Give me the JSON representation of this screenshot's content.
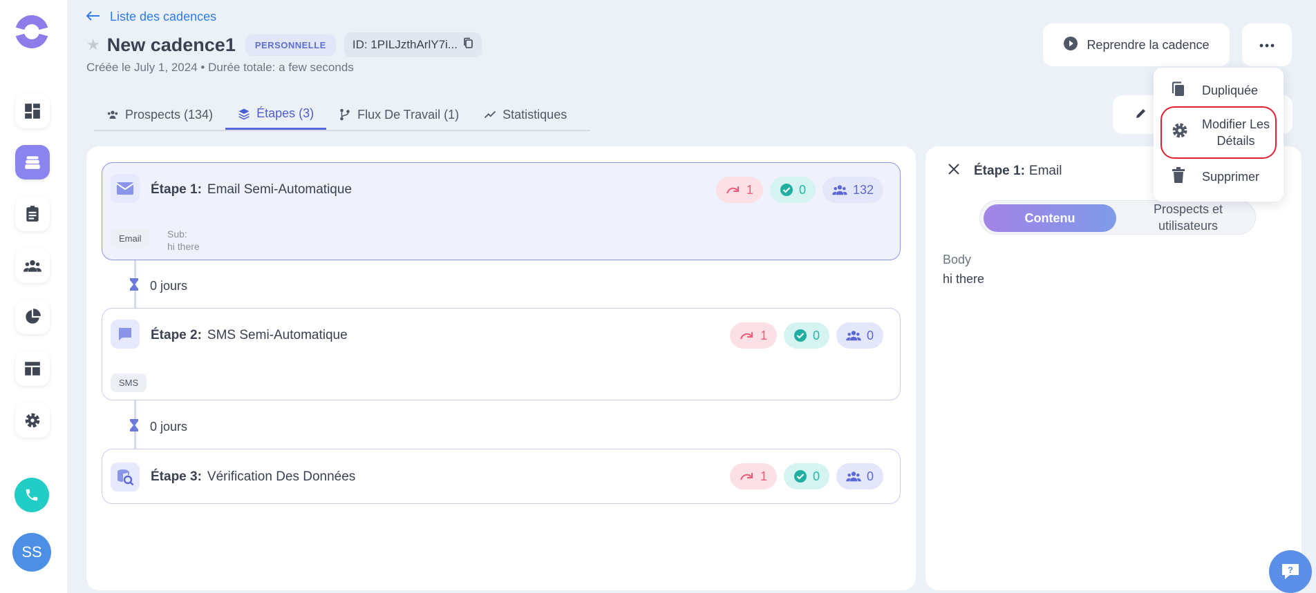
{
  "header": {
    "back_label": "Liste des cadences",
    "title": "New cadence1",
    "badge": "PERSONNELLE",
    "id_label": "ID: 1PILJzthArlY7i...",
    "subtitle": "Créée le July 1, 2024 • Durée totale: a few seconds",
    "resume_label": "Reprendre la cadence"
  },
  "tabs": [
    {
      "label": "Prospects (134)"
    },
    {
      "label": "Étapes (3)"
    },
    {
      "label": "Flux De Travail (1)"
    },
    {
      "label": "Statistiques"
    }
  ],
  "steps": [
    {
      "prefix": "Étape 1:",
      "name": "Email Semi-Automatique",
      "tag": "Email",
      "sub_label": "Sub:",
      "sub_value": "hi there",
      "skipped": "1",
      "done": "0",
      "people": "132"
    },
    {
      "prefix": "Étape 2:",
      "name": "SMS Semi-Automatique",
      "tag": "SMS",
      "skipped": "1",
      "done": "0",
      "people": "0"
    },
    {
      "prefix": "Étape 3:",
      "name": "Vérification Des Données",
      "skipped": "1",
      "done": "0",
      "people": "0"
    }
  ],
  "delays": [
    "0 jours",
    "0 jours"
  ],
  "detail": {
    "prefix": "Étape 1:",
    "name": "Email",
    "tab_content": "Contenu",
    "tab_people": "Prospects et utilisateurs",
    "body_label": "Body",
    "body_text": "hi there"
  },
  "dropdown": {
    "duplicate": "Dupliquée",
    "modify": "Modifier Les Détails",
    "delete": "Supprimer"
  },
  "sidebar": {
    "avatar_initials": "SS",
    "icons": [
      "dashboard-icon",
      "cadence-icon",
      "tasks-icon",
      "people-icon",
      "analytics-icon",
      "templates-icon",
      "settings-icon"
    ]
  },
  "colors": {
    "accent": "#5966d6",
    "active_nav": "#8a85ee",
    "call": "#22cdc5",
    "highlight_border": "#e02030"
  }
}
